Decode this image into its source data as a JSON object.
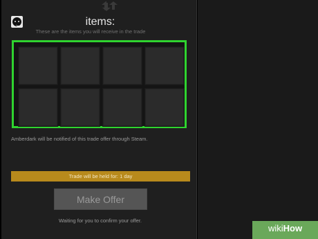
{
  "header": {
    "title": "items:",
    "subtitle": "These are the items you will receive in the trade"
  },
  "items_grid": {
    "slots": [
      {
        "state": "empty"
      },
      {
        "state": "empty"
      },
      {
        "state": "empty"
      },
      {
        "state": "empty"
      },
      {
        "state": "empty"
      },
      {
        "state": "empty"
      },
      {
        "state": "empty"
      },
      {
        "state": "empty"
      }
    ],
    "highlight_color": "#2fd42f"
  },
  "notification_text": "Amberdark will be notified of this trade offer through Steam.",
  "hold_bar": {
    "text": "Trade will be held for: 1 day",
    "color": "#b88a1c"
  },
  "make_offer_button": {
    "label": "Make Offer",
    "state": "disabled"
  },
  "waiting_text": "Waiting for you to confirm your offer.",
  "watermark": {
    "wiki": "wiki",
    "how": "How"
  },
  "icons": {
    "swap": "swap-arrows-icon",
    "avatar": "smiley-avatar-icon"
  }
}
